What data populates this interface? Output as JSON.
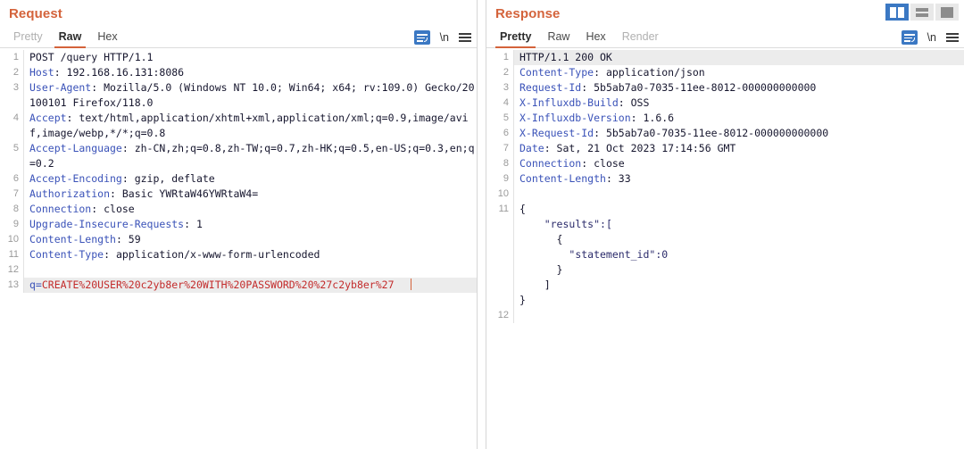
{
  "layout_toggle": {
    "buttons": [
      {
        "name": "split-vertical",
        "label": "Side by side",
        "active": true
      },
      {
        "name": "split-horizontal",
        "label": "Stacked",
        "active": false
      },
      {
        "name": "single-pane",
        "label": "Single pane",
        "active": false
      }
    ]
  },
  "request": {
    "title": "Request",
    "tabs": [
      {
        "label": "Pretty",
        "state": "disabled"
      },
      {
        "label": "Raw",
        "state": "active"
      },
      {
        "label": "Hex",
        "state": "normal"
      }
    ],
    "actions": {
      "wrap_label": "word-wrap",
      "newline_label": "\\n",
      "menu_label": "menu"
    },
    "lines": [
      {
        "n": "1",
        "segments": [
          {
            "t": "POST /query HTTP/1.1",
            "c": "plain"
          }
        ]
      },
      {
        "n": "2",
        "segments": [
          {
            "t": "Host",
            "c": "hdr"
          },
          {
            "t": ": 192.168.16.131:8086",
            "c": "plain"
          }
        ]
      },
      {
        "n": "3",
        "segments": [
          {
            "t": "User-Agent",
            "c": "hdr"
          },
          {
            "t": ": Mozilla/5.0 (Windows NT 10.0; Win64; x64; rv:109.0) Gecko/20100101 Firefox/118.0",
            "c": "plain"
          }
        ]
      },
      {
        "n": "4",
        "segments": [
          {
            "t": "Accept",
            "c": "hdr"
          },
          {
            "t": ": text/html,application/xhtml+xml,application/xml;q=0.9,image/avif,image/webp,*/*;q=0.8",
            "c": "plain"
          }
        ]
      },
      {
        "n": "5",
        "segments": [
          {
            "t": "Accept-Language",
            "c": "hdr"
          },
          {
            "t": ": zh-CN,zh;q=0.8,zh-TW;q=0.7,zh-HK;q=0.5,en-US;q=0.3,en;q=0.2",
            "c": "plain"
          }
        ]
      },
      {
        "n": "6",
        "segments": [
          {
            "t": "Accept-Encoding",
            "c": "hdr"
          },
          {
            "t": ": gzip, deflate",
            "c": "plain"
          }
        ]
      },
      {
        "n": "7",
        "segments": [
          {
            "t": "Authorization",
            "c": "hdr"
          },
          {
            "t": ": Basic YWRtaW46YWRtaW4=",
            "c": "plain"
          }
        ]
      },
      {
        "n": "8",
        "segments": [
          {
            "t": "Connection",
            "c": "hdr"
          },
          {
            "t": ": close",
            "c": "plain"
          }
        ]
      },
      {
        "n": "9",
        "segments": [
          {
            "t": "Upgrade-Insecure-Requests",
            "c": "hdr"
          },
          {
            "t": ": 1",
            "c": "plain"
          }
        ]
      },
      {
        "n": "10",
        "segments": [
          {
            "t": "Content-Length",
            "c": "hdr"
          },
          {
            "t": ": 59",
            "c": "plain"
          }
        ]
      },
      {
        "n": "11",
        "segments": [
          {
            "t": "Content-Type",
            "c": "hdr"
          },
          {
            "t": ": application/x-www-form-urlencoded",
            "c": "plain"
          }
        ]
      },
      {
        "n": "12",
        "segments": []
      },
      {
        "n": "13",
        "highlight": true,
        "caret": true,
        "segments": [
          {
            "t": "q=",
            "c": "body-key"
          },
          {
            "t": "CREATE%20USER%20c2yb8er%20WITH%20PASSWORD%20%27c2yb8er%27",
            "c": "body-val"
          }
        ]
      }
    ]
  },
  "response": {
    "title": "Response",
    "tabs": [
      {
        "label": "Pretty",
        "state": "active"
      },
      {
        "label": "Raw",
        "state": "normal"
      },
      {
        "label": "Hex",
        "state": "normal"
      },
      {
        "label": "Render",
        "state": "disabled"
      }
    ],
    "actions": {
      "wrap_label": "word-wrap",
      "newline_label": "\\n",
      "menu_label": "menu"
    },
    "lines": [
      {
        "n": "1",
        "highlight": true,
        "segments": [
          {
            "t": "HTTP/1.1 200 OK",
            "c": "status-line"
          }
        ]
      },
      {
        "n": "2",
        "segments": [
          {
            "t": "Content-Type",
            "c": "hdr"
          },
          {
            "t": ": application/json",
            "c": "plain"
          }
        ]
      },
      {
        "n": "3",
        "segments": [
          {
            "t": "Request-Id",
            "c": "hdr"
          },
          {
            "t": ": 5b5ab7a0-7035-11ee-8012-000000000000",
            "c": "plain"
          }
        ]
      },
      {
        "n": "4",
        "segments": [
          {
            "t": "X-Influxdb-Build",
            "c": "hdr"
          },
          {
            "t": ": OSS",
            "c": "plain"
          }
        ]
      },
      {
        "n": "5",
        "segments": [
          {
            "t": "X-Influxdb-Version",
            "c": "hdr"
          },
          {
            "t": ": 1.6.6",
            "c": "plain"
          }
        ]
      },
      {
        "n": "6",
        "segments": [
          {
            "t": "X-Request-Id",
            "c": "hdr"
          },
          {
            "t": ": 5b5ab7a0-7035-11ee-8012-000000000000",
            "c": "plain"
          }
        ]
      },
      {
        "n": "7",
        "segments": [
          {
            "t": "Date",
            "c": "hdr"
          },
          {
            "t": ": Sat, 21 Oct 2023 17:14:56 GMT",
            "c": "plain"
          }
        ]
      },
      {
        "n": "8",
        "segments": [
          {
            "t": "Connection",
            "c": "hdr"
          },
          {
            "t": ": close",
            "c": "plain"
          }
        ]
      },
      {
        "n": "9",
        "segments": [
          {
            "t": "Content-Length",
            "c": "hdr"
          },
          {
            "t": ": 33",
            "c": "plain"
          }
        ]
      },
      {
        "n": "10",
        "segments": []
      },
      {
        "n": "11",
        "segments": [
          {
            "t": "{",
            "c": "json-punct"
          }
        ]
      },
      {
        "n": "",
        "segments": [
          {
            "t": "    \"results\":[",
            "c": "json-str"
          }
        ]
      },
      {
        "n": "",
        "segments": [
          {
            "t": "      {",
            "c": "json-punct"
          }
        ]
      },
      {
        "n": "",
        "segments": [
          {
            "t": "        \"statement_id\":0",
            "c": "json-str"
          }
        ]
      },
      {
        "n": "",
        "segments": [
          {
            "t": "      }",
            "c": "json-punct"
          }
        ]
      },
      {
        "n": "",
        "segments": [
          {
            "t": "    ]",
            "c": "json-punct"
          }
        ]
      },
      {
        "n": "",
        "segments": [
          {
            "t": "}",
            "c": "json-punct"
          }
        ]
      },
      {
        "n": "12",
        "segments": []
      }
    ]
  }
}
